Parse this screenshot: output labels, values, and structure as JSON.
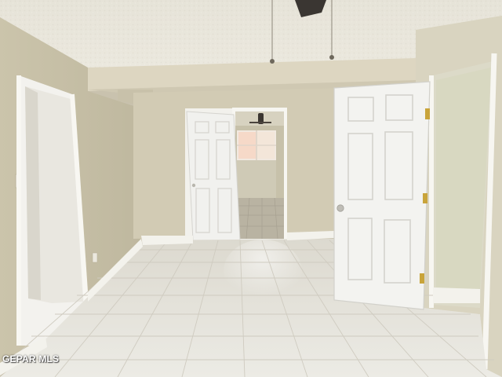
{
  "watermark": {
    "text": "GEPAR MLS"
  },
  "colors": {
    "ceiling": "#e9e6dc",
    "wall_left": "#cdc6af",
    "wall_back": "#d3ccb6",
    "wall_right": "#d9d4c1",
    "soffit": "#ddd7c3",
    "door": "#f2f2ef",
    "door_panel_edge": "#d6d6d0",
    "trim": "#f4f3ee",
    "floor": "#e4e2da",
    "grout": "#cfccc1",
    "hinge": "#c9a43a",
    "fan": "#3a3632"
  }
}
